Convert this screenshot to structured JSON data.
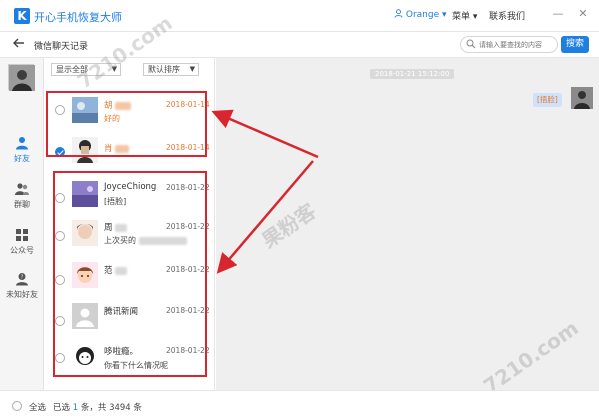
{
  "app": {
    "logo_letter": "K",
    "title": "开心手机恢复大师"
  },
  "topbar": {
    "user_name": "Orange ▾",
    "menu_label": "菜单 ▾",
    "contact_label": "联系我们",
    "minimize": "—",
    "close": "✕"
  },
  "subheader": {
    "title": "微信聊天记录",
    "search_placeholder": "请输入要查找的内容",
    "search_button": "搜索"
  },
  "nav": {
    "items": [
      {
        "label": "好友",
        "icon": "person-icon",
        "active": true
      },
      {
        "label": "群聊",
        "icon": "group-icon",
        "active": false
      },
      {
        "label": "公众号",
        "icon": "grid-icon",
        "active": false
      },
      {
        "label": "未知好友",
        "icon": "unknown-person-icon",
        "active": false
      }
    ]
  },
  "filters": {
    "show": "显示全部",
    "sort": "默认排序"
  },
  "contacts": [
    {
      "name": "胡",
      "date": "2018-01-14",
      "message": "好的",
      "highlight": true,
      "checked": false
    },
    {
      "name": "肖",
      "date": "2018-01-14",
      "message": "",
      "highlight": true,
      "checked": true
    },
    {
      "name": "JoyceChiong",
      "date": "2018-01-22",
      "message": "[捂脸]",
      "highlight": false,
      "checked": false
    },
    {
      "name": "周",
      "date": "2018-01-22",
      "message": "上次买的",
      "highlight": false,
      "checked": false
    },
    {
      "name": "范",
      "date": "2018-01-22",
      "message": "",
      "highlight": false,
      "checked": false
    },
    {
      "name": "腾讯新闻",
      "date": "2018-01-22",
      "message": "",
      "highlight": false,
      "checked": false
    },
    {
      "name": "哆啦瘾。",
      "date": "2018-01-22",
      "message": "你看下什么情况呢",
      "highlight": false,
      "checked": false
    }
  ],
  "chat": {
    "timestamp": "2018-01-21 15:12:00",
    "bubble_text": "[捂脸]"
  },
  "footer": {
    "select_all": "全选",
    "selected_prefix": "已选",
    "selected_count": "1",
    "selected_mid": "条，共",
    "total_count": "3494",
    "selected_suffix": "条"
  },
  "watermarks": [
    "7210.com",
    "果粉客",
    "7210.com"
  ],
  "colors": {
    "accent": "#1e7fe0",
    "highlight_text": "#e8772e",
    "annotation_red": "#d8262e"
  }
}
